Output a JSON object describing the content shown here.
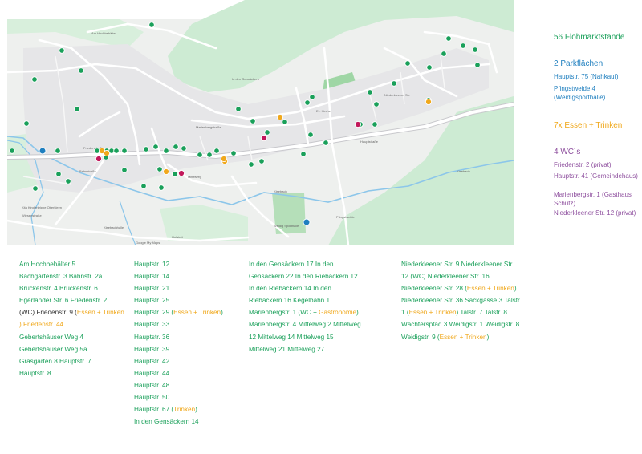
{
  "legend": {
    "stalls": "56 Flohmarktstände",
    "parking_title": "2 Parkflächen",
    "parking_1": "Hauptstr. 75 (Nahkauf)",
    "parking_2": "Pfingstweide 4 (Weidigsporthalle)",
    "food": "7x Essen + Trinken",
    "wc_title": "4 WC´s",
    "wc_1": "Friedenstr. 2 (privat)",
    "wc_2": "Hauptstr. 41 (Gemeindehaus)",
    "wc_3": "Marienbergstr. 1 (Gasthaus Schütz)",
    "wc_4": "Niederkleener Str. 12 (privat)"
  },
  "colors": {
    "green": "#1aa05a",
    "blue": "#1f7fbf",
    "orange": "#f0a81c",
    "purple": "#8e4f9e"
  },
  "map": {
    "labels": {
      "hochbehaelter": "Am Hochbehälter",
      "bahnstr": "Bahnstraße",
      "hauptstrasse": "Hauptstraße",
      "kleebach": "Kleebach",
      "friedenstr": "Friedenstraße",
      "pfingstweide": "Pfingstweide",
      "hofstatt": "Hofstatt",
      "niederkleener": "Niederkleener Str.",
      "marienbergstr": "Marienbergstraße",
      "mittelweg": "Mittelweg",
      "gensaeckern": "In den Gensäckern",
      "wiesenstr": "Wiesenstraße",
      "weidigsporthalle": "Weidig Sporthalle",
      "kleebachhalle": "Kleebachhalle",
      "evkirche": "Ev. Kirche",
      "kita": "Kita Kinderkrippe Oberkleen",
      "google": "Google My Maps"
    }
  },
  "addresses": {
    "col1": [
      "Am Hochbehälter 5",
      "Bachgartenstr. 3 Bahnstr. 2a",
      "Brückenstr. 4 Brückenstr. 6",
      "Egerländer Str. 6 Friedenstr. 2",
      "(WC) Friedenstr. 9 (",
      "Essen + Trinken",
      ") Friedenstr. 44",
      "Gebertshäuser Weg 4",
      "Gebertshäuser Weg 5a",
      "Grasgärten 8 Hauptstr. 7",
      "Hauptstr. 8"
    ],
    "col2": [
      "Hauptstr. 12",
      "Hauptstr. 14",
      "Hauptstr. 21",
      "Hauptstr. 25",
      "Hauptstr. 29 (",
      "Essen + Trinken",
      ")",
      "Hauptstr. 33",
      "Hauptstr. 36",
      "Hauptstr. 39",
      "Hauptstr. 42",
      "Hauptstr. 44",
      "Hauptstr. 48",
      "Hauptstr. 50",
      "Hauptstr. 67 (",
      "Trinken",
      ")",
      "In den Gensäckern 14"
    ],
    "col3": [
      "In den Gensäckern 17 In den",
      "Gensäckern 22 In den Riebäckern 12",
      "In den Riebäckern 14 In den",
      "Riebäckern 16 Kegelbahn 1",
      "Marienbergstr. 1 (WC + ",
      "Gastronomie",
      ")",
      "Marienbergstr. 4 Mittelweg 2 Mittelweg",
      "12 Mittelweg 14 Mittelweg 15",
      "Mittelweg 21 Mittelweg 27"
    ],
    "col4": [
      "Niederkleener Str. 9 Niederkleener Str.",
      "12 (WC) Niederkleener Str. 16",
      "Niederkleener Str. 28 (",
      "Essen + Trinken",
      ")",
      "Niederkleener Str. 36 Sackgasse 3 Talstr.",
      "1 (",
      "Essen + Trinken",
      ") Talstr. 7 Talstr. 8",
      "Wächterspfad 3 Weidigstr. 1 Weidigstr. 8",
      "Weidigstr. 9 (",
      "Essen + Trinken",
      ")"
    ]
  }
}
